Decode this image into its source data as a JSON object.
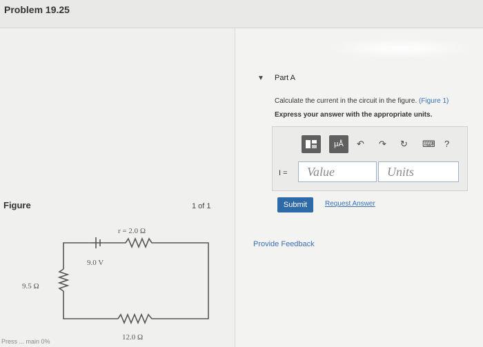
{
  "header": {
    "title": "Problem 19.25"
  },
  "figure": {
    "label": "Figure",
    "pager": "1 of 1",
    "labels": {
      "r": "r = 2.0 Ω",
      "emf": "9.0 V",
      "left_resistor": "9.5 Ω",
      "bottom_resistor": "12.0 Ω"
    }
  },
  "bottom": {
    "status": "Press ... main 0%"
  },
  "part": {
    "title": "Part A",
    "question": "Calculate the current in the circuit in the figure.",
    "figure_link": "(Figure 1)",
    "instruction": "Express your answer with the appropriate units.",
    "toolbar": {
      "template_icon": "template-icon",
      "units_button": "μÅ",
      "undo": "↶",
      "redo": "↷",
      "reset": "↻",
      "keyboard": "⌨",
      "help": "?"
    },
    "input_label": "I =",
    "value_placeholder": "Value",
    "units_placeholder": "Units",
    "submit": "Submit",
    "request_answer": "Request Answer"
  },
  "feedback": "Provide Feedback"
}
